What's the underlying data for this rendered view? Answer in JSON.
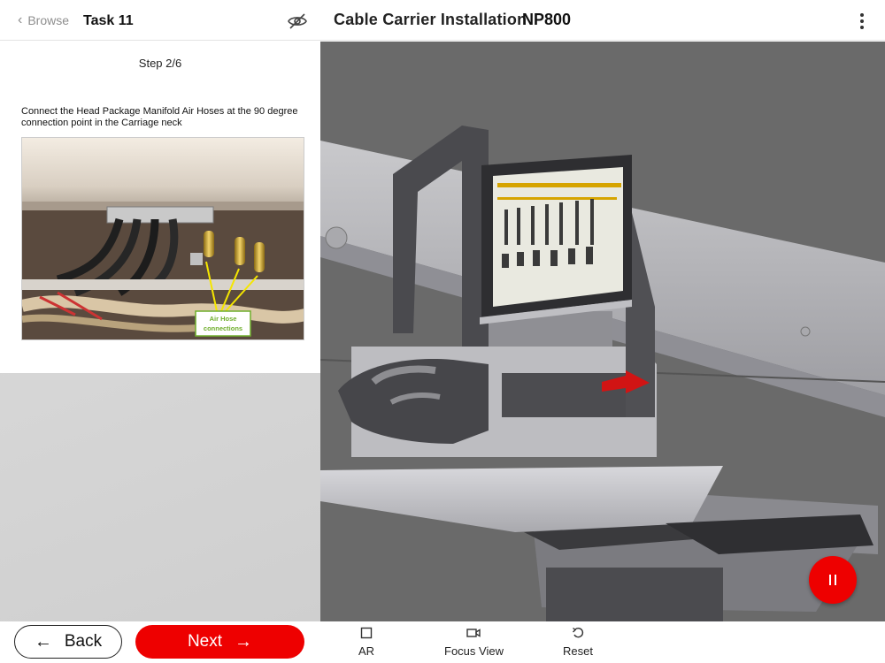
{
  "header": {
    "back_label": "Browse",
    "task_title": "Task 11",
    "main_title": "Cable Carrier Installation",
    "model": "NP800"
  },
  "instruction": {
    "step": "Step 2/6",
    "text": "Connect the Head Package Manifold Air Hoses at the 90 degree connection point in the Carriage neck",
    "photo_label_line1": "Air Hose",
    "photo_label_line2": "connections"
  },
  "footer": {
    "back_label": "Back",
    "next_label": "Next",
    "tools": [
      {
        "label": "AR",
        "icon": "square-icon"
      },
      {
        "label": "Focus View",
        "icon": "video-camera-icon"
      },
      {
        "label": "Reset",
        "icon": "undo-icon"
      }
    ]
  },
  "colors": {
    "accent": "#ee0000",
    "viewport_bg": "#6b6b6b",
    "photo_callout": "#6fae2b"
  }
}
